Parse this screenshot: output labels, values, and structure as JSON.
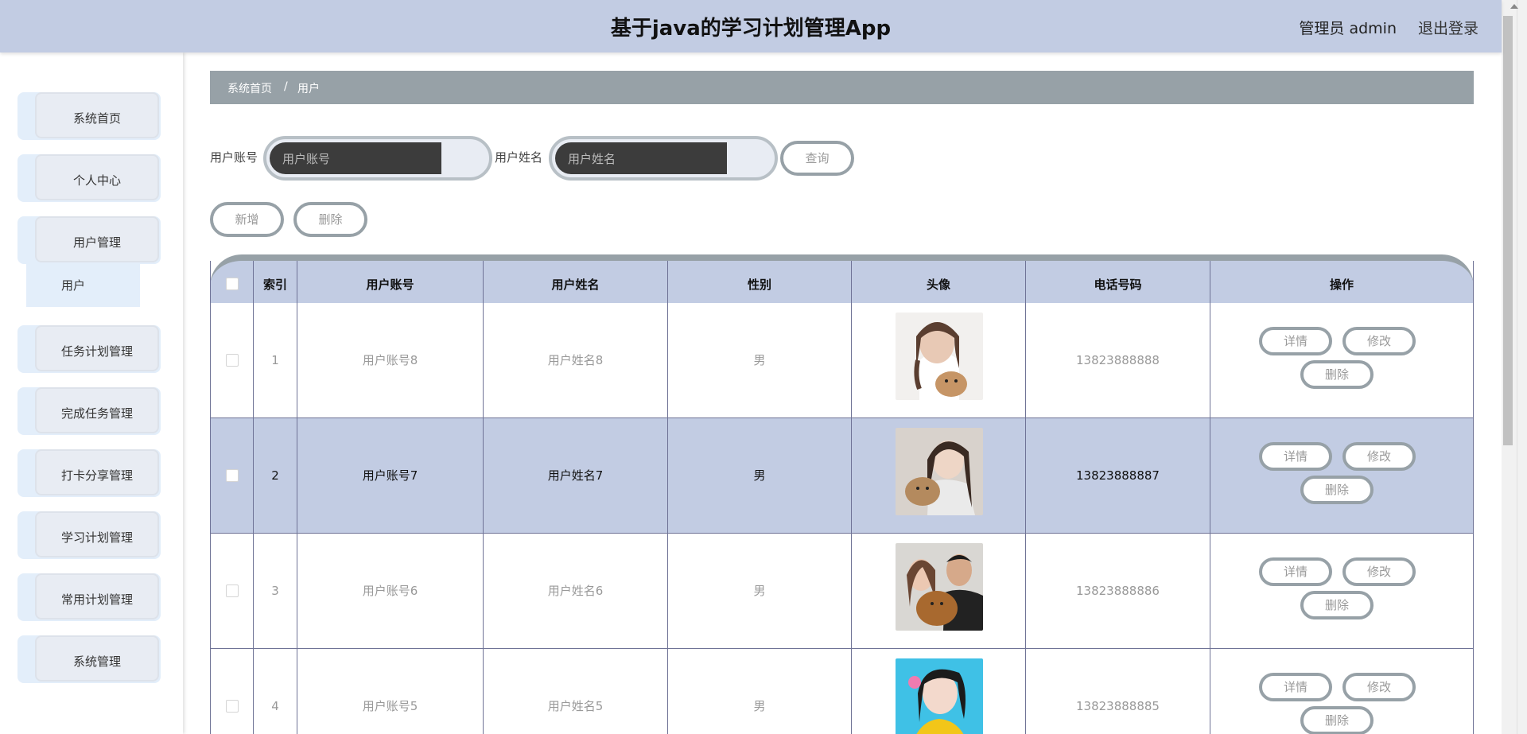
{
  "header": {
    "title": "基于java的学习计划管理App",
    "admin_label": "管理员 admin",
    "logout_label": "退出登录"
  },
  "sidebar": {
    "items": [
      {
        "label": "系统首页"
      },
      {
        "label": "个人中心"
      },
      {
        "label": "用户管理"
      },
      {
        "label": "任务计划管理"
      },
      {
        "label": "完成任务管理"
      },
      {
        "label": "打卡分享管理"
      },
      {
        "label": "学习计划管理"
      },
      {
        "label": "常用计划管理"
      },
      {
        "label": "系统管理"
      }
    ],
    "submenu": {
      "label": "用户"
    }
  },
  "breadcrumb": {
    "home": "系统首页",
    "separator": "/",
    "current": "用户"
  },
  "search": {
    "account_label": "用户账号",
    "account_placeholder": "用户账号",
    "name_label": "用户姓名",
    "name_placeholder": "用户姓名",
    "query_button": "查询"
  },
  "actions": {
    "add_button": "新增",
    "delete_button": "删除"
  },
  "table": {
    "columns": [
      "索引",
      "用户账号",
      "用户姓名",
      "性别",
      "头像",
      "电话号码",
      "操作"
    ],
    "rows": [
      {
        "index": "1",
        "account": "用户账号8",
        "name": "用户姓名8",
        "gender": "男",
        "phone": "13823888888",
        "highlighted": false
      },
      {
        "index": "2",
        "account": "用户账号7",
        "name": "用户姓名7",
        "gender": "男",
        "phone": "13823888887",
        "highlighted": true
      },
      {
        "index": "3",
        "account": "用户账号6",
        "name": "用户姓名6",
        "gender": "男",
        "phone": "13823888886",
        "highlighted": false
      },
      {
        "index": "4",
        "account": "用户账号5",
        "name": "用户姓名5",
        "gender": "男",
        "phone": "13823888885",
        "highlighted": false
      }
    ],
    "row_actions": {
      "detail": "详情",
      "edit": "修改",
      "delete": "删除"
    }
  },
  "colors": {
    "header_bg": "#c2cce3",
    "breadcrumb_bg": "#97a1a7",
    "highlight_row": "#c2cce3",
    "button_border": "#97a1a7"
  }
}
